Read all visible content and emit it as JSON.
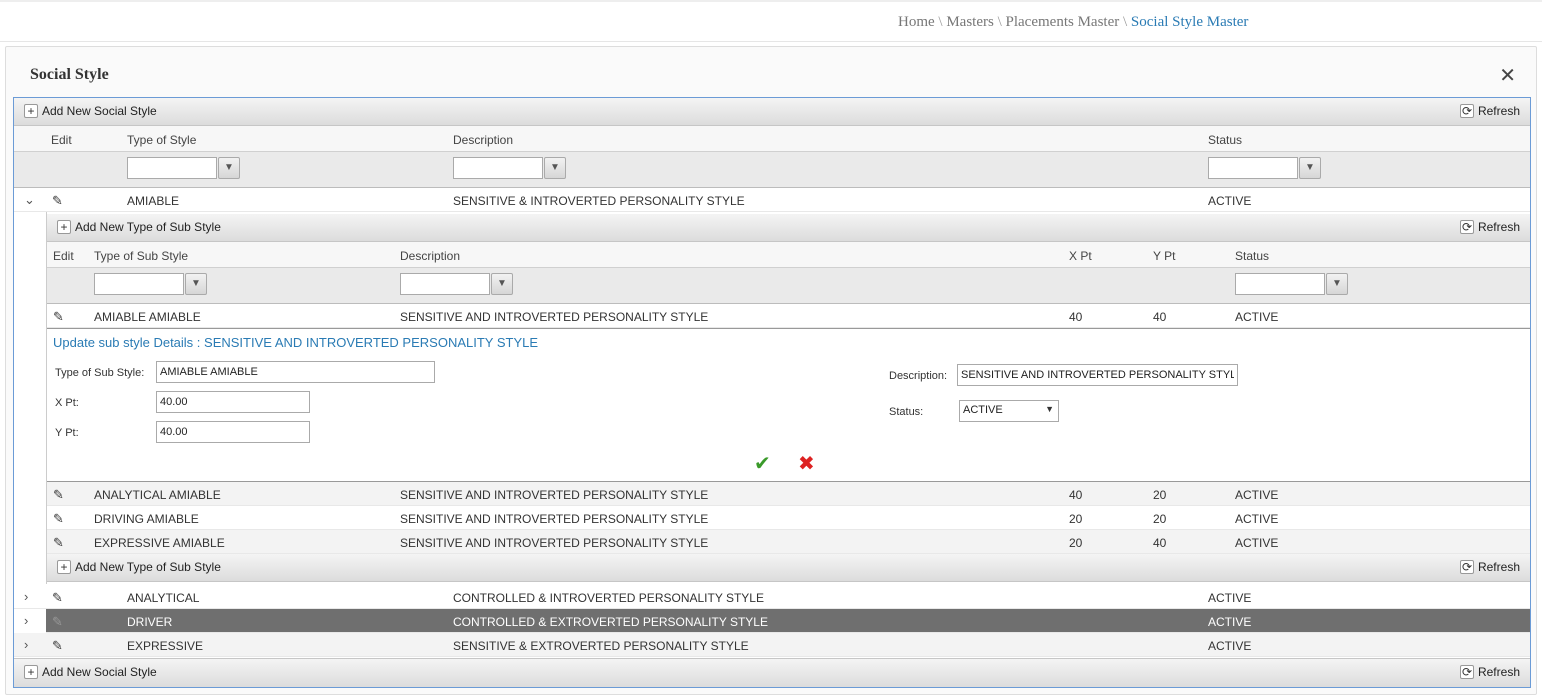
{
  "breadcrumb": {
    "home": "Home",
    "masters": "Masters",
    "placements": "Placements Master",
    "current": "Social Style Master",
    "sep": "\\"
  },
  "panel": {
    "title": "Social Style",
    "close_icon": "✕"
  },
  "grid": {
    "add_label": "Add New Social Style",
    "refresh_label": "Refresh",
    "headers": {
      "edit": "Edit",
      "type": "Type of Style",
      "description": "Description",
      "status": "Status"
    },
    "rows": [
      {
        "type": "AMIABLE",
        "description": "SENSITIVE & INTROVERTED PERSONALITY STYLE",
        "status": "ACTIVE",
        "expanded": true
      },
      {
        "type": "ANALYTICAL",
        "description": "CONTROLLED & INTROVERTED PERSONALITY STYLE",
        "status": "ACTIVE"
      },
      {
        "type": "DRIVER",
        "description": "CONTROLLED & EXTROVERTED PERSONALITY STYLE",
        "status": "ACTIVE",
        "selected": true
      },
      {
        "type": "EXPRESSIVE",
        "description": "SENSITIVE & EXTROVERTED PERSONALITY STYLE",
        "status": "ACTIVE"
      }
    ]
  },
  "subgrid": {
    "add_label": "Add New Type of Sub Style",
    "refresh_label": "Refresh",
    "headers": {
      "edit": "Edit",
      "type": "Type of Sub Style",
      "description": "Description",
      "xpt": "X Pt",
      "ypt": "Y Pt",
      "status": "Status"
    },
    "rows": [
      {
        "type": "AMIABLE AMIABLE",
        "description": "SENSITIVE AND INTROVERTED PERSONALITY STYLE",
        "xpt": "40",
        "ypt": "40",
        "status": "ACTIVE"
      },
      {
        "type": "ANALYTICAL AMIABLE",
        "description": "SENSITIVE AND INTROVERTED PERSONALITY STYLE",
        "xpt": "40",
        "ypt": "20",
        "status": "ACTIVE"
      },
      {
        "type": "DRIVING AMIABLE",
        "description": "SENSITIVE AND INTROVERTED PERSONALITY STYLE",
        "xpt": "20",
        "ypt": "20",
        "status": "ACTIVE"
      },
      {
        "type": "EXPRESSIVE AMIABLE",
        "description": "SENSITIVE AND INTROVERTED PERSONALITY STYLE",
        "xpt": "20",
        "ypt": "40",
        "status": "ACTIVE"
      }
    ]
  },
  "edit_form": {
    "title": "Update sub style Details : SENSITIVE AND INTROVERTED PERSONALITY STYLE",
    "type_label": "Type of Sub Style:",
    "type_value": "AMIABLE AMIABLE",
    "xpt_label": "X Pt:",
    "xpt_value": "40.00",
    "ypt_label": "Y Pt:",
    "ypt_value": "40.00",
    "description_label": "Description:",
    "description_value": "SENSITIVE AND INTROVERTED PERSONALITY STYLE",
    "status_label": "Status:",
    "status_value": "ACTIVE"
  },
  "icons": {
    "plus": "+",
    "refresh": "⟳",
    "filter": "▼",
    "pencil": "✎",
    "chevron_down": "⌄",
    "chevron_right": "›",
    "check": "✔",
    "cancel": "✖",
    "caret": "▼"
  },
  "colors": {
    "accent": "#2a7bb4",
    "selected_row": "#6f6f6f",
    "ok": "#3a9a2a",
    "cancel": "#dd2222"
  }
}
